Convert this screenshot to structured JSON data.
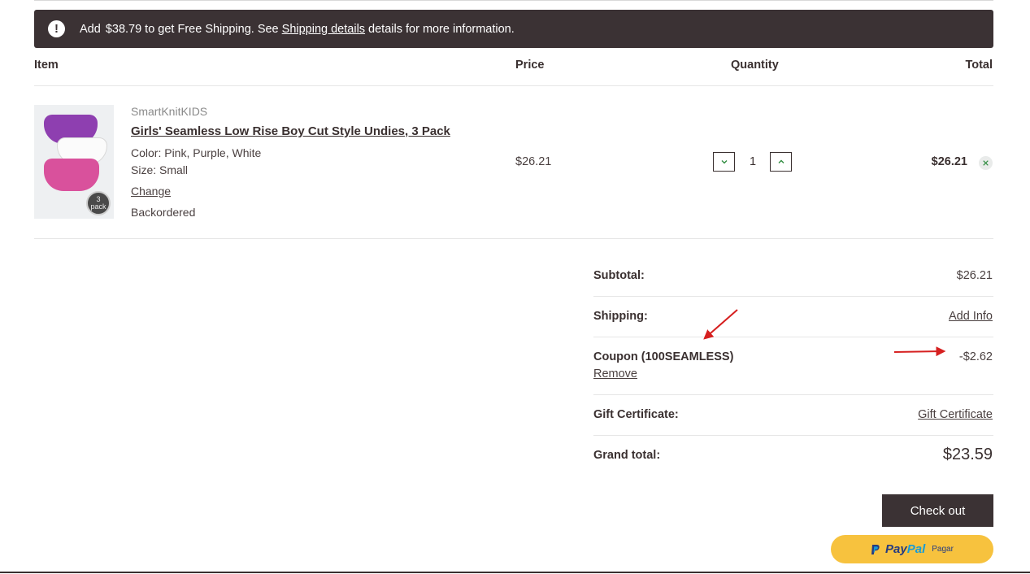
{
  "notice": {
    "prefix": "Add",
    "amount": "$38.79",
    "middle": "to get Free Shipping. See",
    "link": "Shipping details",
    "suffix": "details for more information."
  },
  "columns": {
    "item": "Item",
    "price": "Price",
    "quantity": "Quantity",
    "total": "Total"
  },
  "cart_item": {
    "brand": "SmartKnitKIDS",
    "name": "Girls' Seamless Low Rise Boy Cut Style Undies, 3 Pack",
    "color": "Color: Pink, Purple, White",
    "size": "Size: Small",
    "change_label": "Change",
    "status": "Backordered",
    "thumb_badge_top": "3",
    "thumb_badge_bottom": "pack",
    "price": "$26.21",
    "quantity": "1",
    "total": "$26.21"
  },
  "summary": {
    "subtotal_label": "Subtotal:",
    "subtotal_value": "$26.21",
    "shipping_label": "Shipping:",
    "shipping_link": "Add Info",
    "coupon_label": "Coupon (100SEAMLESS)",
    "coupon_remove": "Remove",
    "coupon_value": "-$2.62",
    "gift_label": "Gift Certificate:",
    "gift_link": "Gift Certificate",
    "grand_label": "Grand total:",
    "grand_value": "$23.59"
  },
  "actions": {
    "checkout_label": "Check out",
    "paypal_pay": "Pay",
    "paypal_pal": "Pal",
    "paypal_sub": "Pagar"
  },
  "colors": {
    "dark": "#3b3234",
    "paypal_yellow": "#f7c23e",
    "annotation_red": "#d62020"
  }
}
